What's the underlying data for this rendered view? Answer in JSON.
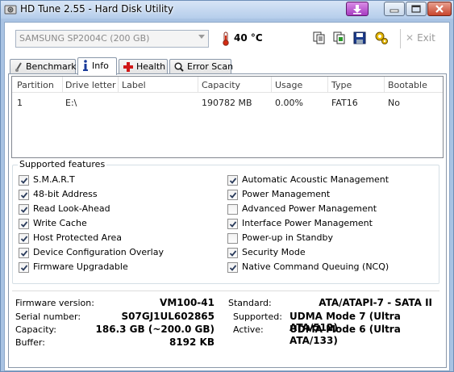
{
  "window": {
    "title": "HD Tune 2.55 - Hard Disk Utility"
  },
  "toolbar": {
    "drive": "SAMSUNG SP2004C (200 GB)",
    "temperature": "40 °C",
    "exit_label": "Exit",
    "icons": [
      "copy-text-icon",
      "copy-screenshot-icon",
      "save-icon",
      "options-icon"
    ]
  },
  "tabs": [
    {
      "label": "Benchmark",
      "icon": "benchmark-icon"
    },
    {
      "label": "Info",
      "icon": "info-icon",
      "active": true
    },
    {
      "label": "Health",
      "icon": "health-icon"
    },
    {
      "label": "Error Scan",
      "icon": "error-scan-icon"
    }
  ],
  "partitions": {
    "columns": [
      "Partition",
      "Drive letter",
      "Label",
      "Capacity",
      "Usage",
      "Type",
      "Bootable"
    ],
    "rows": [
      {
        "partition": "1",
        "drive_letter": "E:\\",
        "label": "",
        "capacity": "190782 MB",
        "usage": "0.00%",
        "type": "FAT16",
        "bootable": "No"
      }
    ]
  },
  "features": {
    "title": "Supported features",
    "left": [
      {
        "label": "S.M.A.R.T",
        "checked": true
      },
      {
        "label": "48-bit Address",
        "checked": true
      },
      {
        "label": "Read Look-Ahead",
        "checked": true
      },
      {
        "label": "Write Cache",
        "checked": true
      },
      {
        "label": "Host Protected Area",
        "checked": true
      },
      {
        "label": "Device Configuration Overlay",
        "checked": true
      },
      {
        "label": "Firmware Upgradable",
        "checked": true
      }
    ],
    "right": [
      {
        "label": "Automatic Acoustic Management",
        "checked": true
      },
      {
        "label": "Power Management",
        "checked": true
      },
      {
        "label": "Advanced Power Management",
        "checked": false
      },
      {
        "label": "Interface Power Management",
        "checked": true
      },
      {
        "label": "Power-up in Standby",
        "checked": false
      },
      {
        "label": "Security Mode",
        "checked": true
      },
      {
        "label": "Native Command Queuing (NCQ)",
        "checked": true
      }
    ]
  },
  "info": {
    "firmware_label": "Firmware version:",
    "firmware": "VM100-41",
    "serial_label": "Serial number:",
    "serial": "S07GJ1UL602865",
    "capacity_label": "Capacity:",
    "capacity": "186.3 GB (~200.0 GB)",
    "buffer_label": "Buffer:",
    "buffer": "8192 KB",
    "standard_label": "Standard:",
    "standard": "ATA/ATAPI-7 - SATA II",
    "supported_label": "Supported:",
    "supported": "UDMA Mode 7 (Ultra ATA/512)",
    "active_label": "Active:",
    "active": "UDMA Mode 6 (Ultra ATA/133)"
  }
}
